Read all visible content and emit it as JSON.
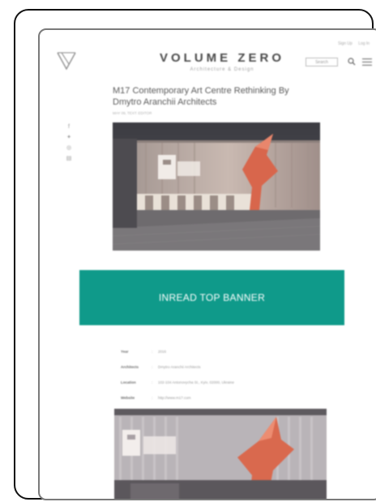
{
  "site": {
    "name": "VOLUME ZERO",
    "tagline": "Architecture & Design",
    "top_links": [
      "Sign Up",
      "Log In"
    ],
    "search_placeholder": "Search"
  },
  "article": {
    "title_line1": "M17 Contemporary Art Centre Rethinking By",
    "title_line2": "Dmytro Aranchii Architects",
    "meta": "MAY 09, TEXT: EDITOR"
  },
  "share_icons": [
    "facebook-icon",
    "twitter-icon",
    "pinterest-icon",
    "email-icon"
  ],
  "banner": {
    "label": "INREAD TOP BANNER",
    "color": "#0f9a8a"
  },
  "project_info": [
    {
      "key": "Year",
      "value": "2016"
    },
    {
      "key": "Architects",
      "value": "Dmytro Aranchii Architects"
    },
    {
      "key": "Location",
      "value": "102-104 Antonovycha St., Kyiv, 02000, Ukraine"
    },
    {
      "key": "Website",
      "value": "http://www.m17.com"
    }
  ],
  "colors": {
    "accent": "#0f9a8a",
    "frame": "#111111"
  }
}
